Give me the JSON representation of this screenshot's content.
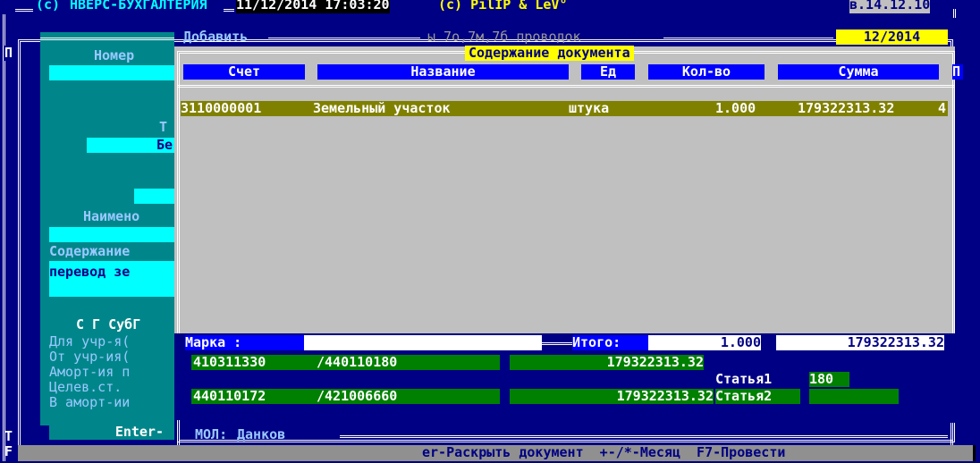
{
  "title_bar": {
    "copyright": "(c)",
    "app": "НВЕРС-БУХГАЛТЕРИЯ",
    "datetime": "11/12/2014 17:03:20",
    "author": "(c) PilIP & LeV°",
    "version": "в.14.12.10"
  },
  "back_dialog": {
    "title": "Добавить",
    "subtitle": "ы 7о,7м,7б проводок",
    "period": "12/2014"
  },
  "left_form": {
    "label_p": "П",
    "nomer_label": "Номер",
    "t_label": "Т",
    "be_value": "Бе",
    "naimeno_label": "Наимено",
    "soderzhanie_label": "Содержание",
    "perevod_text": "перевод зе",
    "cols_label": "С Г СубГ",
    "rows": [
      "Для учр-я(",
      "От учр-ия(",
      "Аморт-ия п",
      "Целев.ст.",
      "В аморт-ии"
    ],
    "enter_label": "Enter-",
    "left_t": "T",
    "left_f": "F"
  },
  "dialog": {
    "title": "Содержание документа",
    "columns": [
      "Счет",
      "Название",
      "Ед",
      "Кол-во",
      "Сумма",
      "П"
    ],
    "rows": [
      {
        "account": "3110000001",
        "name": "Земельный участок",
        "unit": "штука",
        "qty": "1.000",
        "sum": "179322313.32",
        "p": "4"
      }
    ]
  },
  "bottom": {
    "marka_label": "Марка :",
    "marka_value": "",
    "itogo_label": "Итого:",
    "itogo_qty": "1.000",
    "itogo_sum": "179322313.32",
    "entries": [
      {
        "debit": "410311330",
        "credit": "/440110180",
        "sum": "179322313.32"
      },
      {
        "debit": "440110172",
        "credit": "/421006660",
        "sum": "179322313.32"
      }
    ],
    "statya1_label": "Статья1",
    "statya1_value": "180",
    "statya2_label": "Статья2",
    "statya2_value": "",
    "mol_label": "МОЛ:",
    "mol_value": "Данков"
  },
  "status_bar": {
    "text": "er-Раскрыть документ  +-/*-Месяц  F7-Провести"
  },
  "colors": {
    "screen_bg": "#000084",
    "dialog_bg": "#c0c0c0",
    "header_bg": "#0000ff",
    "selected_row": "#808000",
    "cyan": "#00ffff",
    "green": "#008000",
    "yellow": "#ffff00",
    "teal": "#008080",
    "gray_bar": "#909090",
    "white": "#ffffff"
  }
}
